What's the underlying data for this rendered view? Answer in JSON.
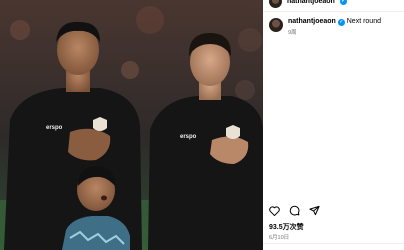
{
  "post": {
    "author_username": "nathantjoeaon",
    "comment": {
      "username": "nathantjoeaon",
      "text": "Next round",
      "time": "9周"
    },
    "likes": "93.5万次赞",
    "date": "6月10日"
  },
  "photo": {
    "jersey_brand_1": "erspo",
    "jersey_brand_2": "erspo"
  },
  "colors": {
    "verified": "#0095f6",
    "secondary_text": "#737373"
  },
  "icons": [
    "heart-icon",
    "comment-icon",
    "share-icon",
    "verified-icon"
  ]
}
